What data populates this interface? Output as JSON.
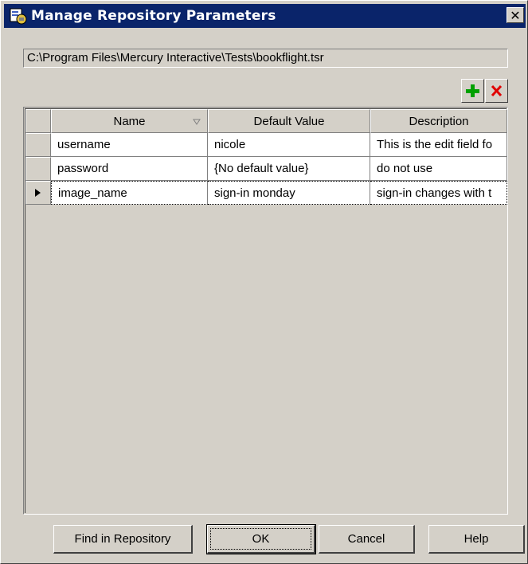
{
  "window": {
    "title": "Manage Repository Parameters",
    "close_glyph": "✕"
  },
  "repository_path": "C:\\Program Files\\Mercury Interactive\\Tests\\bookflight.tsr",
  "toolbar": {
    "add_icon": "plus-icon",
    "delete_icon": "delete-x-icon"
  },
  "table": {
    "columns": [
      "Name",
      "Default Value",
      "Description"
    ],
    "rows": [
      {
        "name": "username",
        "default_value": "nicole",
        "description": "This is the edit field fo",
        "selected": false
      },
      {
        "name": "password",
        "default_value": "{No default value}",
        "description": "do not use",
        "selected": false
      },
      {
        "name": "image_name",
        "default_value": "sign-in monday",
        "description": "sign-in changes with t",
        "selected": true
      }
    ]
  },
  "buttons": {
    "find": "Find in Repository",
    "ok": "OK",
    "cancel": "Cancel",
    "help": "Help"
  },
  "colors": {
    "titlebar": "#0a246a",
    "add": "#00a000",
    "delete": "#e00000",
    "face": "#d4d0c8"
  }
}
